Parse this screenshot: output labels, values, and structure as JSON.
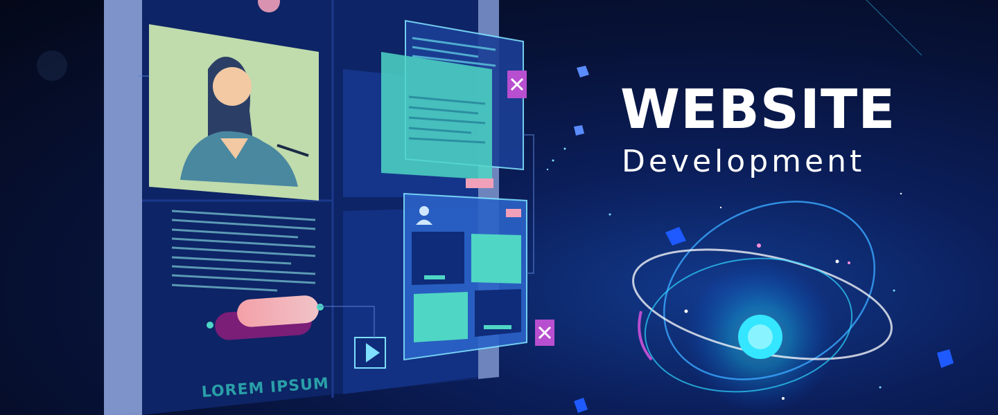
{
  "headline": {
    "title": "WEBSITE",
    "subtitle": "Development"
  },
  "illustration": {
    "caption": "LOREM IPSUM"
  },
  "colors": {
    "background": "#071238",
    "accent_cyan": "#34e6ff",
    "accent_pink": "#b84fd0",
    "panel_teal": "#4fd6c4",
    "monitor_frame": "#8fa6d8"
  },
  "icons": [
    "close-icon",
    "close-icon",
    "play-icon",
    "user-icon"
  ]
}
